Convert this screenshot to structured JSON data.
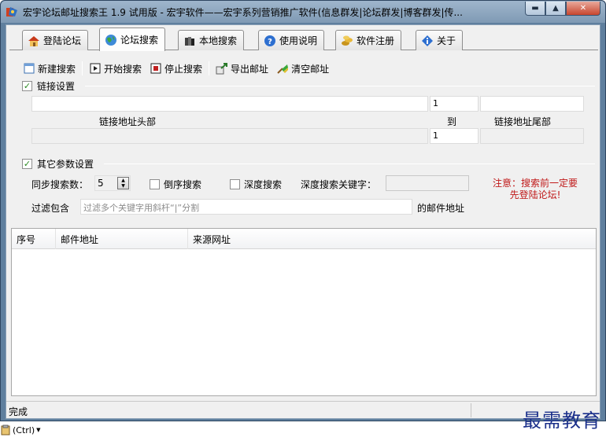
{
  "window": {
    "title": "宏宇论坛邮址搜索王 1.9 试用版 - 宏宇软件——宏宇系列营销推广软件(信息群发|论坛群发|博客群发|传..."
  },
  "tabs": [
    {
      "label": "登陆论坛",
      "icon": "home-icon"
    },
    {
      "label": "论坛搜索",
      "icon": "globe-icon"
    },
    {
      "label": "本地搜索",
      "icon": "books-icon"
    },
    {
      "label": "使用说明",
      "icon": "help-icon"
    },
    {
      "label": "软件注册",
      "icon": "coins-icon"
    },
    {
      "label": "关于",
      "icon": "info-icon"
    }
  ],
  "toolbar": {
    "new_search": "新建搜索",
    "start_search": "开始搜索",
    "stop_search": "停止搜索",
    "export_email": "导出邮址",
    "clear_email": "清空邮址"
  },
  "link_settings": {
    "title": "链接设置",
    "checked": true,
    "start_value": "1",
    "end_value": "1",
    "head_label": "链接地址头部",
    "to_label": "到",
    "tail_label": "链接地址尾部"
  },
  "other_settings": {
    "title": "其它参数设置",
    "checked": true,
    "sync_label": "同步搜索数：",
    "sync_value": "5",
    "reverse_label": "倒序搜索",
    "deep_label": "深度搜索",
    "deep_keyword_label": "深度搜索关键字：",
    "filter_label": "过滤包含",
    "filter_placeholder": "过滤多个关键字用斜杆“|”分割",
    "filter_suffix": "的邮件地址",
    "notice_line1": "注意：搜索前一定要",
    "notice_line2": "先登陆论坛!"
  },
  "results": {
    "columns": [
      "序号",
      "邮件地址",
      "来源网址"
    ]
  },
  "status": {
    "text": "完成"
  },
  "clipboard": {
    "label": "(Ctrl)"
  },
  "watermark": "最需教育"
}
